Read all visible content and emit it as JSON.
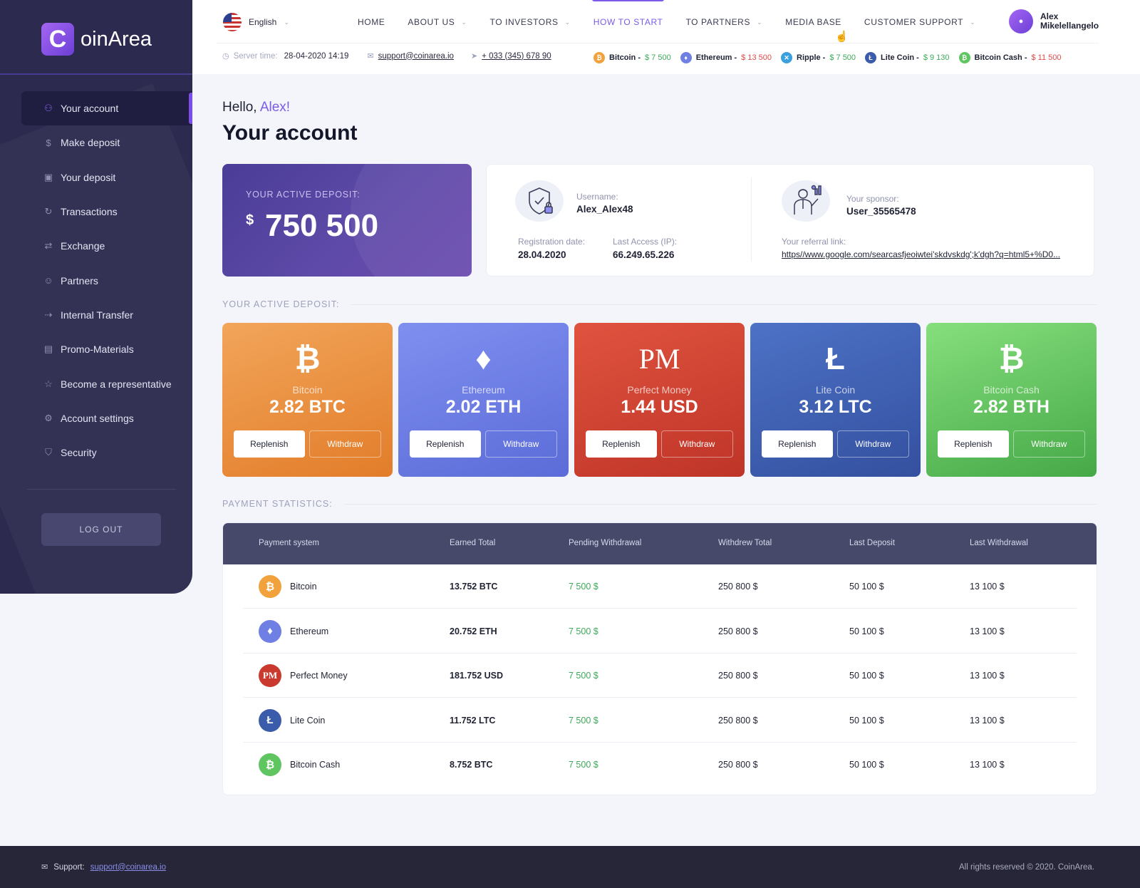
{
  "brand": {
    "logo_letter": "C",
    "logo_text": "oinArea"
  },
  "sidebar": {
    "items": [
      {
        "label": "Your account",
        "icon": "user-icon",
        "active": true
      },
      {
        "label": "Make deposit",
        "icon": "dollar-coin-icon"
      },
      {
        "label": "Your deposit",
        "icon": "wallet-icon"
      },
      {
        "label": "Transactions",
        "icon": "refresh-icon"
      },
      {
        "label": "Exchange",
        "icon": "exchange-icon"
      },
      {
        "label": "Partners",
        "icon": "smile-icon"
      },
      {
        "label": "Internal Transfer",
        "icon": "transfer-icon"
      },
      {
        "label": "Promo-Materials",
        "icon": "bookmark-icon"
      },
      {
        "label": "Become a representative",
        "icon": "star-icon"
      },
      {
        "label": "Account settings",
        "icon": "gear-icon"
      },
      {
        "label": "Security",
        "icon": "shield-icon"
      }
    ],
    "logout_label": "LOG OUT"
  },
  "header": {
    "language": "English",
    "menu": [
      {
        "label": "HOME",
        "dropdown": false
      },
      {
        "label": "ABOUT US",
        "dropdown": true
      },
      {
        "label": "TO INVESTORS",
        "dropdown": true
      },
      {
        "label": "HOW TO START",
        "dropdown": false,
        "current": true
      },
      {
        "label": "TO PARTNERS",
        "dropdown": true
      },
      {
        "label": "MEDIA BASE",
        "dropdown": false
      },
      {
        "label": "CUSTOMER SUPPORT",
        "dropdown": true
      }
    ],
    "user_name": "Alex Mikelellangelo",
    "server_time_label": "Server time:",
    "server_time": "28-04-2020 14:19",
    "email": "support@coinarea.io",
    "phone": "+ 033 (345) 678 90",
    "ticker": [
      {
        "name": "Bitcoin -",
        "price": "$ 7 500",
        "trend": "up",
        "color": "#f1a23c",
        "symbol": "₿"
      },
      {
        "name": "Ethereum -",
        "price": "$ 13 500",
        "trend": "down",
        "color": "#6f7fe4",
        "symbol": "♦"
      },
      {
        "name": "Ripple -",
        "price": "$ 7 500",
        "trend": "up",
        "color": "#3aa0e0",
        "symbol": "✕"
      },
      {
        "name": "Lite Coin -",
        "price": "$ 9 130",
        "trend": "up",
        "color": "#3b5cab",
        "symbol": "Ł"
      },
      {
        "name": "Bitcoin Cash -",
        "price": "$ 11 500",
        "trend": "down",
        "color": "#5fc560",
        "symbol": "₿"
      }
    ]
  },
  "main": {
    "greeting": "Hello,",
    "greeting_name": "Alex!",
    "title": "Your account",
    "deposit_label": "YOUR ACTIVE DEPOSIT:",
    "deposit_currency": "$",
    "deposit_value": "750 500",
    "profile": {
      "username_label": "Username:",
      "username": "Alex_Alex48",
      "registration_label": "Registration date:",
      "registration": "28.04.2020",
      "last_access_label": "Last Access (IP):",
      "last_access": "66.249.65.226",
      "sponsor_label": "Your sponsor:",
      "sponsor": "User_35565478",
      "referral_label": "Your referral link:",
      "referral": "https//www.google.com/searcasfjeoiwtei'skdvskdg';k'dgh?q=html5+%D0..."
    },
    "active_deposit_section": "YOUR ACTIVE DEPOSIT:",
    "coins": [
      {
        "symbol": "₿",
        "name": "Bitcoin",
        "amount": "2.82 BTC",
        "gradient": [
          "#f2a55a",
          "#e27d2a"
        ]
      },
      {
        "symbol": "♦",
        "name": "Ethereum",
        "amount": "2.02 ETH",
        "gradient": [
          "#7f8ff0",
          "#5b6cd8"
        ]
      },
      {
        "symbol": "PM",
        "name": "Perfect Money",
        "amount": "1.44 USD",
        "gradient": [
          "#e0533f",
          "#be3427"
        ]
      },
      {
        "symbol": "Ł",
        "name": "Lite Coin",
        "amount": "3.12 LTC",
        "gradient": [
          "#4d72c6",
          "#34509f"
        ]
      },
      {
        "symbol": "₿",
        "name": "Bitcoin Cash",
        "amount": "2.82 BTH",
        "gradient": [
          "#86df7c",
          "#45a847"
        ]
      }
    ],
    "replenish_label": "Replenish",
    "withdraw_label": "Withdraw",
    "stats_section": "PAYMENT STATISTICS:",
    "stats_columns": [
      "Payment system",
      "Earned Total",
      "Pending Withdrawal",
      "Withdrew Total",
      "Last Deposit",
      "Last Withdrawal"
    ],
    "stats_rows": [
      {
        "name": "Bitcoin",
        "icon": "bitcoin-icon",
        "symbol": "₿",
        "color": "#f1a23c",
        "earned": "13.752 BTC",
        "pending": "7 500 $",
        "withdrew": "250 800 $",
        "last_deposit": "50 100 $",
        "last_withdrawal": "13 100 $"
      },
      {
        "name": "Ethereum",
        "icon": "ethereum-icon",
        "symbol": "♦",
        "color": "#6f7fe4",
        "earned": "20.752 ETH",
        "pending": "7 500 $",
        "withdrew": "250 800 $",
        "last_deposit": "50 100 $",
        "last_withdrawal": "13 100 $"
      },
      {
        "name": "Perfect Money",
        "icon": "perfect-money-icon",
        "symbol": "PM",
        "color": "#c9392e",
        "earned": "181.752 USD",
        "pending": "7 500 $",
        "withdrew": "250 800 $",
        "last_deposit": "50 100 $",
        "last_withdrawal": "13 100 $"
      },
      {
        "name": "Lite Coin",
        "icon": "litecoin-icon",
        "symbol": "Ł",
        "color": "#3b5cab",
        "earned": "11.752 LTC",
        "pending": "7 500 $",
        "withdrew": "250 800 $",
        "last_deposit": "50 100 $",
        "last_withdrawal": "13 100 $"
      },
      {
        "name": "Bitcoin Cash",
        "icon": "bitcoin-cash-icon",
        "symbol": "₿",
        "color": "#5fc560",
        "earned": "8.752 BTC",
        "pending": "7 500 $",
        "withdrew": "250 800 $",
        "last_deposit": "50 100 $",
        "last_withdrawal": "13 100 $"
      }
    ]
  },
  "footer": {
    "support_label": "Support:",
    "support_email": "support@coinarea.io",
    "copyright": "All rights reserved © 2020. CoinArea."
  },
  "colors": {
    "accent": "#7b5be8",
    "sidebar": "#2c2b4f",
    "positive": "#3daa5a",
    "negative": "#e04a4a"
  }
}
